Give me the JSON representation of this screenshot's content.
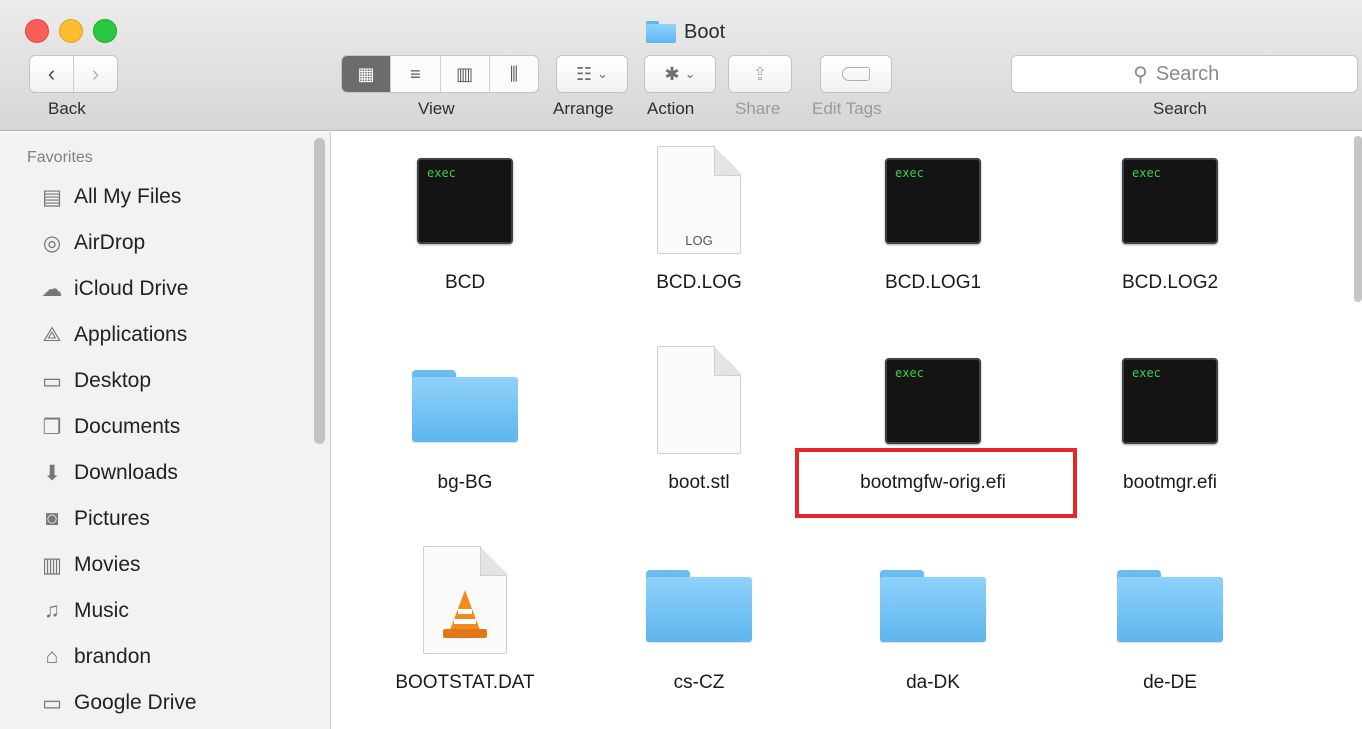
{
  "window": {
    "title": "Boot"
  },
  "toolbar": {
    "back_label": "Back",
    "view_label": "View",
    "arrange_label": "Arrange",
    "action_label": "Action",
    "share_label": "Share",
    "edit_tags_label": "Edit Tags",
    "search_label": "Search",
    "search_placeholder": "Search",
    "view_modes": [
      "icon",
      "list",
      "column",
      "cover-flow"
    ],
    "active_view": "icon"
  },
  "sidebar": {
    "heading": "Favorites",
    "items": [
      {
        "label": "All My Files",
        "icon": "all-files-icon",
        "glyph": "▤"
      },
      {
        "label": "AirDrop",
        "icon": "airdrop-icon",
        "glyph": "◎"
      },
      {
        "label": "iCloud Drive",
        "icon": "cloud-icon",
        "glyph": "☁"
      },
      {
        "label": "Applications",
        "icon": "applications-icon",
        "glyph": "⟁"
      },
      {
        "label": "Desktop",
        "icon": "desktop-icon",
        "glyph": "▭"
      },
      {
        "label": "Documents",
        "icon": "documents-icon",
        "glyph": "❐"
      },
      {
        "label": "Downloads",
        "icon": "downloads-icon",
        "glyph": "⬇"
      },
      {
        "label": "Pictures",
        "icon": "pictures-icon",
        "glyph": "◙"
      },
      {
        "label": "Movies",
        "icon": "movies-icon",
        "glyph": "▥"
      },
      {
        "label": "Music",
        "icon": "music-icon",
        "glyph": "♫"
      },
      {
        "label": "brandon",
        "icon": "home-icon",
        "glyph": "⌂"
      },
      {
        "label": "Google Drive",
        "icon": "folder-icon",
        "glyph": "▭"
      }
    ]
  },
  "files": [
    {
      "name": "BCD",
      "kind": "exec",
      "icon_text": "exec"
    },
    {
      "name": "BCD.LOG",
      "kind": "doc",
      "icon_text": "LOG"
    },
    {
      "name": "BCD.LOG1",
      "kind": "exec",
      "icon_text": "exec"
    },
    {
      "name": "BCD.LOG2",
      "kind": "exec",
      "icon_text": "exec"
    },
    {
      "name": "bg-BG",
      "kind": "folder"
    },
    {
      "name": "boot.stl",
      "kind": "doc",
      "icon_text": ""
    },
    {
      "name": "bootmgfw-orig.efi",
      "kind": "exec",
      "icon_text": "exec",
      "highlighted": true
    },
    {
      "name": "bootmgr.efi",
      "kind": "exec",
      "icon_text": "exec"
    },
    {
      "name": "BOOTSTAT.DAT",
      "kind": "vlc"
    },
    {
      "name": "cs-CZ",
      "kind": "folder"
    },
    {
      "name": "da-DK",
      "kind": "folder"
    },
    {
      "name": "de-DE",
      "kind": "folder"
    }
  ],
  "colors": {
    "highlight": "#e8262e",
    "exec_text": "#35d04c",
    "folder": "#5fb5ee"
  }
}
